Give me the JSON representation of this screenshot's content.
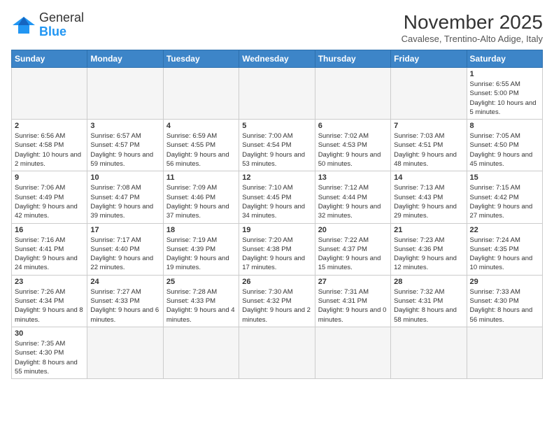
{
  "header": {
    "logo_line1": "General",
    "logo_line2": "Blue",
    "month": "November 2025",
    "location": "Cavalese, Trentino-Alto Adige, Italy"
  },
  "weekdays": [
    "Sunday",
    "Monday",
    "Tuesday",
    "Wednesday",
    "Thursday",
    "Friday",
    "Saturday"
  ],
  "weeks": [
    [
      {
        "day": "",
        "info": "",
        "empty": true
      },
      {
        "day": "",
        "info": "",
        "empty": true
      },
      {
        "day": "",
        "info": "",
        "empty": true
      },
      {
        "day": "",
        "info": "",
        "empty": true
      },
      {
        "day": "",
        "info": "",
        "empty": true
      },
      {
        "day": "",
        "info": "",
        "empty": true
      },
      {
        "day": "1",
        "info": "Sunrise: 6:55 AM\nSunset: 5:00 PM\nDaylight: 10 hours and 5 minutes."
      }
    ],
    [
      {
        "day": "2",
        "info": "Sunrise: 6:56 AM\nSunset: 4:58 PM\nDaylight: 10 hours and 2 minutes."
      },
      {
        "day": "3",
        "info": "Sunrise: 6:57 AM\nSunset: 4:57 PM\nDaylight: 9 hours and 59 minutes."
      },
      {
        "day": "4",
        "info": "Sunrise: 6:59 AM\nSunset: 4:55 PM\nDaylight: 9 hours and 56 minutes."
      },
      {
        "day": "5",
        "info": "Sunrise: 7:00 AM\nSunset: 4:54 PM\nDaylight: 9 hours and 53 minutes."
      },
      {
        "day": "6",
        "info": "Sunrise: 7:02 AM\nSunset: 4:53 PM\nDaylight: 9 hours and 50 minutes."
      },
      {
        "day": "7",
        "info": "Sunrise: 7:03 AM\nSunset: 4:51 PM\nDaylight: 9 hours and 48 minutes."
      },
      {
        "day": "8",
        "info": "Sunrise: 7:05 AM\nSunset: 4:50 PM\nDaylight: 9 hours and 45 minutes."
      }
    ],
    [
      {
        "day": "9",
        "info": "Sunrise: 7:06 AM\nSunset: 4:49 PM\nDaylight: 9 hours and 42 minutes."
      },
      {
        "day": "10",
        "info": "Sunrise: 7:08 AM\nSunset: 4:47 PM\nDaylight: 9 hours and 39 minutes."
      },
      {
        "day": "11",
        "info": "Sunrise: 7:09 AM\nSunset: 4:46 PM\nDaylight: 9 hours and 37 minutes."
      },
      {
        "day": "12",
        "info": "Sunrise: 7:10 AM\nSunset: 4:45 PM\nDaylight: 9 hours and 34 minutes."
      },
      {
        "day": "13",
        "info": "Sunrise: 7:12 AM\nSunset: 4:44 PM\nDaylight: 9 hours and 32 minutes."
      },
      {
        "day": "14",
        "info": "Sunrise: 7:13 AM\nSunset: 4:43 PM\nDaylight: 9 hours and 29 minutes."
      },
      {
        "day": "15",
        "info": "Sunrise: 7:15 AM\nSunset: 4:42 PM\nDaylight: 9 hours and 27 minutes."
      }
    ],
    [
      {
        "day": "16",
        "info": "Sunrise: 7:16 AM\nSunset: 4:41 PM\nDaylight: 9 hours and 24 minutes."
      },
      {
        "day": "17",
        "info": "Sunrise: 7:17 AM\nSunset: 4:40 PM\nDaylight: 9 hours and 22 minutes."
      },
      {
        "day": "18",
        "info": "Sunrise: 7:19 AM\nSunset: 4:39 PM\nDaylight: 9 hours and 19 minutes."
      },
      {
        "day": "19",
        "info": "Sunrise: 7:20 AM\nSunset: 4:38 PM\nDaylight: 9 hours and 17 minutes."
      },
      {
        "day": "20",
        "info": "Sunrise: 7:22 AM\nSunset: 4:37 PM\nDaylight: 9 hours and 15 minutes."
      },
      {
        "day": "21",
        "info": "Sunrise: 7:23 AM\nSunset: 4:36 PM\nDaylight: 9 hours and 12 minutes."
      },
      {
        "day": "22",
        "info": "Sunrise: 7:24 AM\nSunset: 4:35 PM\nDaylight: 9 hours and 10 minutes."
      }
    ],
    [
      {
        "day": "23",
        "info": "Sunrise: 7:26 AM\nSunset: 4:34 PM\nDaylight: 9 hours and 8 minutes."
      },
      {
        "day": "24",
        "info": "Sunrise: 7:27 AM\nSunset: 4:33 PM\nDaylight: 9 hours and 6 minutes."
      },
      {
        "day": "25",
        "info": "Sunrise: 7:28 AM\nSunset: 4:33 PM\nDaylight: 9 hours and 4 minutes."
      },
      {
        "day": "26",
        "info": "Sunrise: 7:30 AM\nSunset: 4:32 PM\nDaylight: 9 hours and 2 minutes."
      },
      {
        "day": "27",
        "info": "Sunrise: 7:31 AM\nSunset: 4:31 PM\nDaylight: 9 hours and 0 minutes."
      },
      {
        "day": "28",
        "info": "Sunrise: 7:32 AM\nSunset: 4:31 PM\nDaylight: 8 hours and 58 minutes."
      },
      {
        "day": "29",
        "info": "Sunrise: 7:33 AM\nSunset: 4:30 PM\nDaylight: 8 hours and 56 minutes."
      }
    ],
    [
      {
        "day": "30",
        "info": "Sunrise: 7:35 AM\nSunset: 4:30 PM\nDaylight: 8 hours and 55 minutes."
      },
      {
        "day": "",
        "info": "",
        "empty": true
      },
      {
        "day": "",
        "info": "",
        "empty": true
      },
      {
        "day": "",
        "info": "",
        "empty": true
      },
      {
        "day": "",
        "info": "",
        "empty": true
      },
      {
        "day": "",
        "info": "",
        "empty": true
      },
      {
        "day": "",
        "info": "",
        "empty": true
      }
    ]
  ]
}
